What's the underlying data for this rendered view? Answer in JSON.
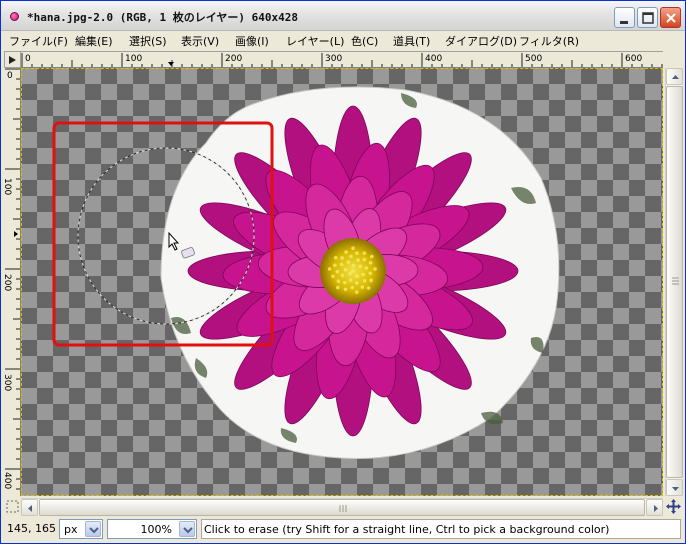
{
  "window": {
    "title": "*hana.jpg-2.0 (RGB, 1 枚のレイヤー) 640x428"
  },
  "menu": {
    "items": [
      {
        "label": "ファイル(F)"
      },
      {
        "label": "編集(E)"
      },
      {
        "label": "選択(S)"
      },
      {
        "label": "表示(V)"
      },
      {
        "label": "画像(I)"
      },
      {
        "label": "レイヤー(L)"
      },
      {
        "label": "色(C)"
      },
      {
        "label": "道具(T)"
      },
      {
        "label": "ダイアログ(D)"
      },
      {
        "label": "フィルタ(R)"
      }
    ]
  },
  "rulers": {
    "horizontal_ticks": [
      "0",
      "100",
      "200",
      "300",
      "400",
      "500",
      "600"
    ],
    "vertical_ticks": [
      "0",
      "100",
      "200",
      "300",
      "400"
    ]
  },
  "canvas": {
    "image": "dahlia-flower-photo",
    "image_width": 640,
    "image_height": 428,
    "highlight_color": "#e01010",
    "flower_color": "#c8138f",
    "center_color": "#e8c800"
  },
  "statusbar": {
    "coords": "145, 165",
    "unit": "px",
    "zoom": "100%",
    "message": "Click to erase (try Shift for a straight line, Ctrl to pick a background color)"
  }
}
